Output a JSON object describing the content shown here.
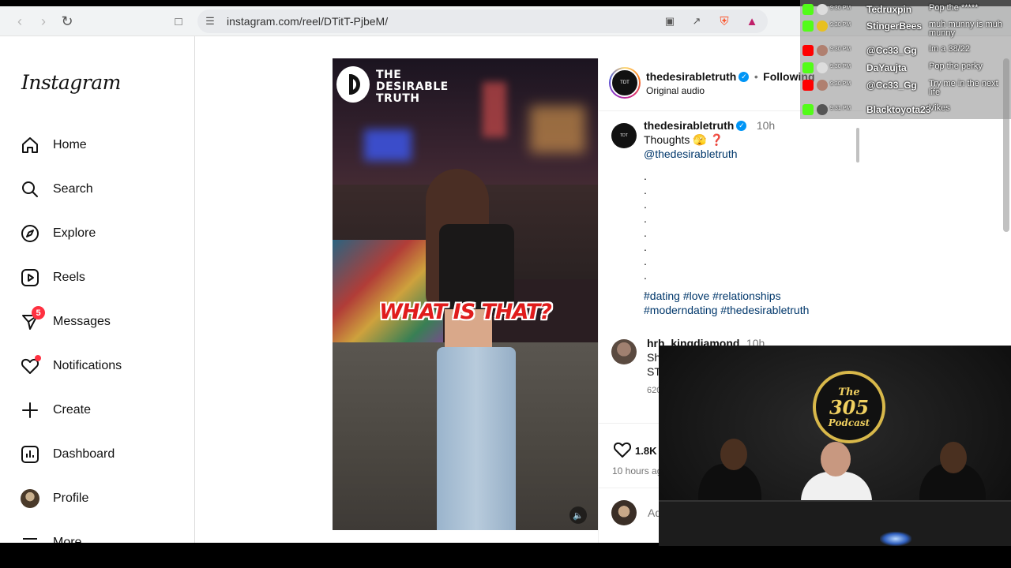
{
  "browser": {
    "url": "instagram.com/reel/DTitT-PjbeM/"
  },
  "sidebar": {
    "logo": "Instagram",
    "items": [
      {
        "label": "Home",
        "icon": "home-icon"
      },
      {
        "label": "Search",
        "icon": "search-icon"
      },
      {
        "label": "Explore",
        "icon": "compass-icon"
      },
      {
        "label": "Reels",
        "icon": "reels-icon"
      },
      {
        "label": "Messages",
        "icon": "messenger-icon",
        "badge": "5"
      },
      {
        "label": "Notifications",
        "icon": "heart-icon"
      },
      {
        "label": "Create",
        "icon": "plus-icon"
      },
      {
        "label": "Dashboard",
        "icon": "dashboard-icon"
      },
      {
        "label": "Profile",
        "icon": "avatar"
      },
      {
        "label": "More",
        "icon": "menu-icon"
      }
    ]
  },
  "video": {
    "brand_line1": "THE",
    "brand_line2": "DESIRABLE",
    "brand_line3": "TRUTH",
    "caption": "WHAT IS THAT?"
  },
  "post": {
    "username": "thedesirabletruth",
    "following": "Following",
    "audio": "Original audio",
    "caption_user": "thedesirabletruth",
    "caption_time": "10h",
    "caption_text": "Thoughts 🫣 ❓",
    "mention": "@thedesirabletruth",
    "hashtags_line1": "#dating #love #relationships",
    "hashtags_line2": "#moderndating #thedesirabletruth",
    "comment_user": "hrh_kingdiamond",
    "comment_time": "10h",
    "comment_line1": "Sh",
    "comment_line2": "ST",
    "comment_likes": "620",
    "likes": "1.8K",
    "timestamp": "10 hours ag",
    "add_comment_placeholder": "Ad"
  },
  "chat": {
    "rows": [
      {
        "time": "9:30 PM",
        "name": "Tedruxpin",
        "msg": "Pop the *****"
      },
      {
        "time": "9:30 PM",
        "name": "StingerBees",
        "msg": "muh munny is muh munny"
      },
      {
        "time": "9:30 PM",
        "name": "@Cc33_Gg",
        "msg": "Im a 38/22"
      },
      {
        "time": "9:30 PM",
        "name": "DaYaujta",
        "msg": "Pop the perky"
      },
      {
        "time": "9:30 PM",
        "name": "@Cc33_Gg",
        "msg": "Try me in the next life"
      },
      {
        "time": "9:31 PM",
        "name": "Blacktoyota23",
        "msg": "Vikes"
      }
    ]
  },
  "cam": {
    "logo_top": "The",
    "logo_mid": "305",
    "logo_bottom": "Podcast"
  }
}
